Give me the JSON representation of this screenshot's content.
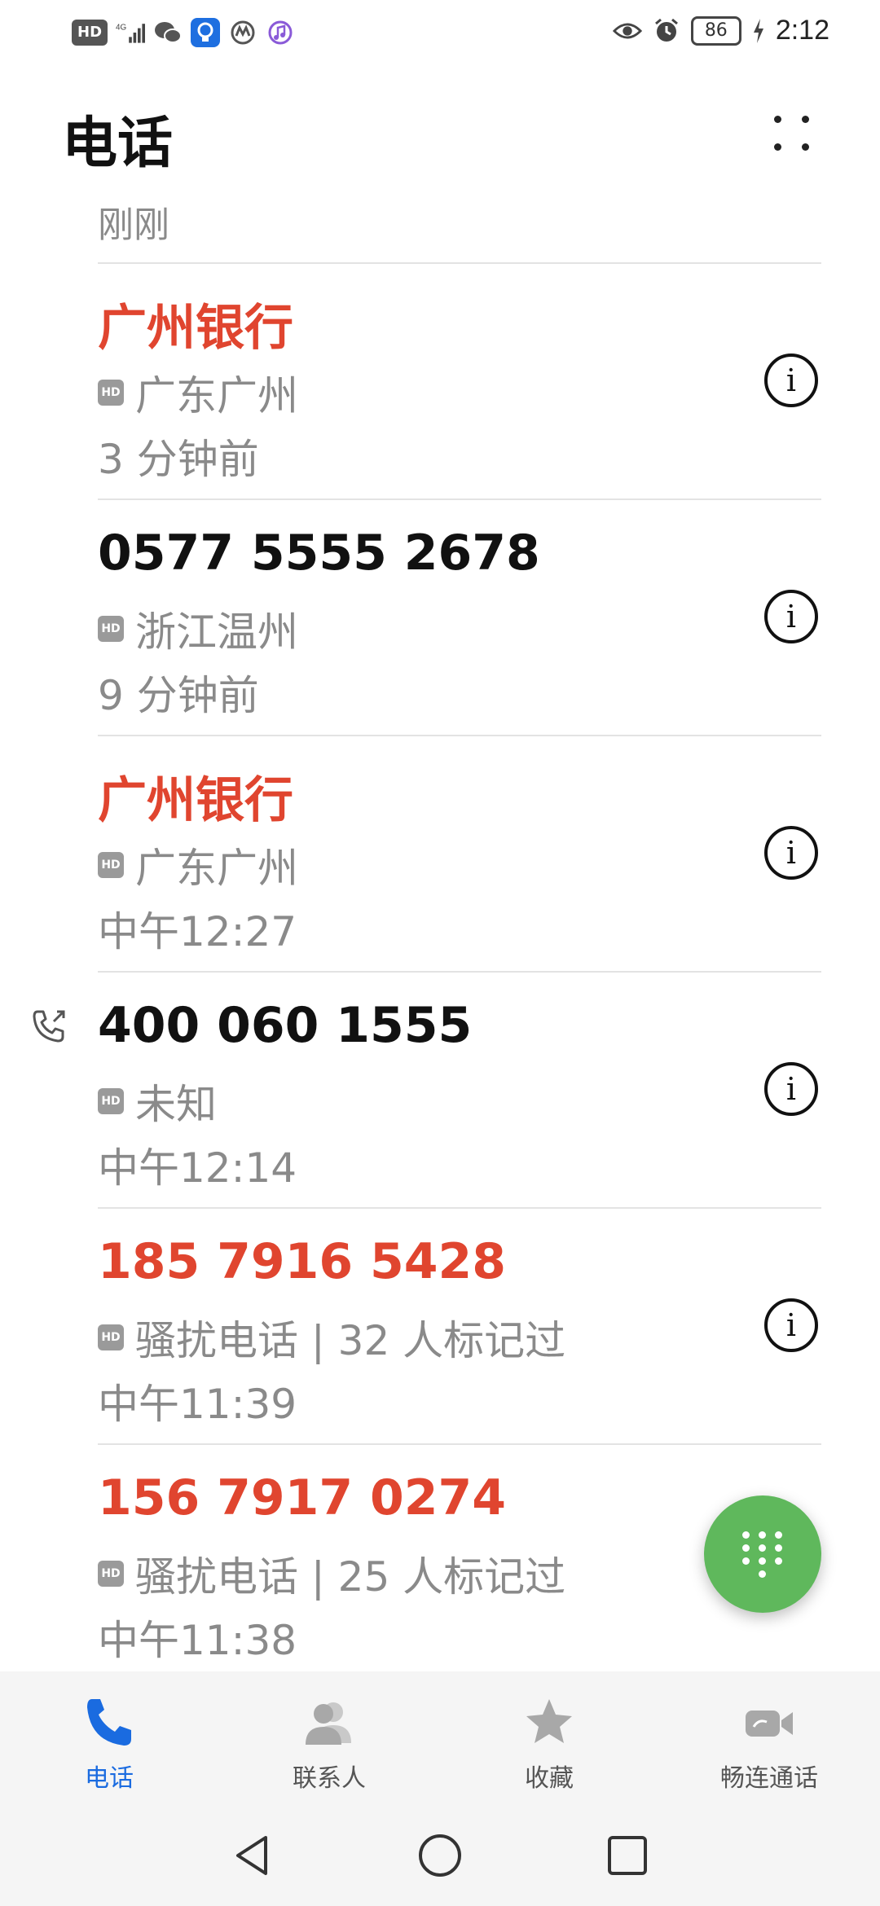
{
  "status_bar": {
    "left_icons": [
      "hd-icon",
      "signal-4g-icon",
      "wechat-icon",
      "bulb-icon",
      "app-icon",
      "music-icon"
    ],
    "hd_label": "HD",
    "battery": "86",
    "time": "2:12"
  },
  "header": {
    "title": "电话",
    "more_icon": "more-dots-icon"
  },
  "section_label": "刚刚",
  "calls": [
    {
      "name": "广州银行",
      "location": "广东广州",
      "time": "3 分钟前",
      "missed": true,
      "outgoing": false
    },
    {
      "name": "0577 5555 2678",
      "location": "浙江温州",
      "time": "9 分钟前",
      "missed": false,
      "outgoing": false
    },
    {
      "name": "广州银行",
      "location": "广东广州",
      "time": "中午12:27",
      "missed": true,
      "outgoing": false
    },
    {
      "name": "400 060 1555",
      "location": "未知",
      "time": "中午12:14",
      "missed": false,
      "outgoing": true
    },
    {
      "name": "185 7916 5428",
      "location": "骚扰电话 | 32 人标记过",
      "time": "中午11:39",
      "missed": true,
      "outgoing": false
    },
    {
      "name": "156 7917 0274",
      "location": "骚扰电话 | 25 人标记过",
      "time": "中午11:38",
      "missed": true,
      "outgoing": false
    }
  ],
  "hd_badge": "HD",
  "info_glyph": "i",
  "bottom_nav": [
    {
      "label": "电话",
      "icon": "phone-icon",
      "active": true
    },
    {
      "label": "联系人",
      "icon": "contacts-icon",
      "active": false
    },
    {
      "label": "收藏",
      "icon": "star-icon",
      "active": false
    },
    {
      "label": "畅连通话",
      "icon": "video-call-icon",
      "active": false
    }
  ],
  "colors": {
    "missed": "#e0452f",
    "accent": "#1a6be0",
    "fab": "#5fb85c",
    "secondary_text": "#8a8a8a"
  }
}
